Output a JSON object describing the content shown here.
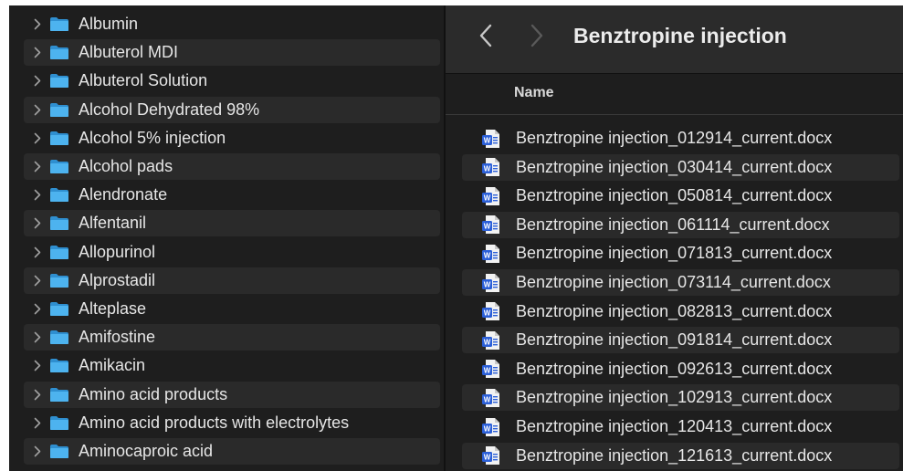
{
  "folders": [
    {
      "label": "Albumin"
    },
    {
      "label": "Albuterol MDI"
    },
    {
      "label": "Albuterol Solution"
    },
    {
      "label": "Alcohol  Dehydrated 98%"
    },
    {
      "label": "Alcohol 5% injection"
    },
    {
      "label": "Alcohol pads"
    },
    {
      "label": "Alendronate"
    },
    {
      "label": "Alfentanil"
    },
    {
      "label": "Allopurinol"
    },
    {
      "label": "Alprostadil"
    },
    {
      "label": "Alteplase"
    },
    {
      "label": "Amifostine"
    },
    {
      "label": "Amikacin"
    },
    {
      "label": "Amino acid products"
    },
    {
      "label": "Amino acid products with electrolytes"
    },
    {
      "label": "Aminocaproic acid"
    }
  ],
  "toolbar": {
    "title": "Benztropine injection",
    "back_icon": "chevron-left-icon",
    "forward_icon": "chevron-right-icon"
  },
  "list_header": {
    "name": "Name"
  },
  "files": [
    {
      "name": "Benztropine injection_012914_current.docx"
    },
    {
      "name": "Benztropine injection_030414_current.docx"
    },
    {
      "name": "Benztropine injection_050814_current.docx"
    },
    {
      "name": "Benztropine injection_061114_current.docx"
    },
    {
      "name": "Benztropine injection_071813_current.docx"
    },
    {
      "name": "Benztropine injection_073114_current.docx"
    },
    {
      "name": "Benztropine injection_082813_current.docx"
    },
    {
      "name": "Benztropine injection_091814_current.docx"
    },
    {
      "name": "Benztropine injection_092613_current.docx"
    },
    {
      "name": "Benztropine injection_102913_current.docx"
    },
    {
      "name": "Benztropine injection_120413_current.docx"
    },
    {
      "name": "Benztropine injection_121613_current.docx"
    }
  ],
  "colors": {
    "background": "#1e1e1e",
    "toolbar": "#2b2b2b",
    "row_alt": "#2a2a2a",
    "folder_blue": "#3ea8e8",
    "word_blue": "#2b5fd8",
    "text": "#e6e6e6"
  }
}
